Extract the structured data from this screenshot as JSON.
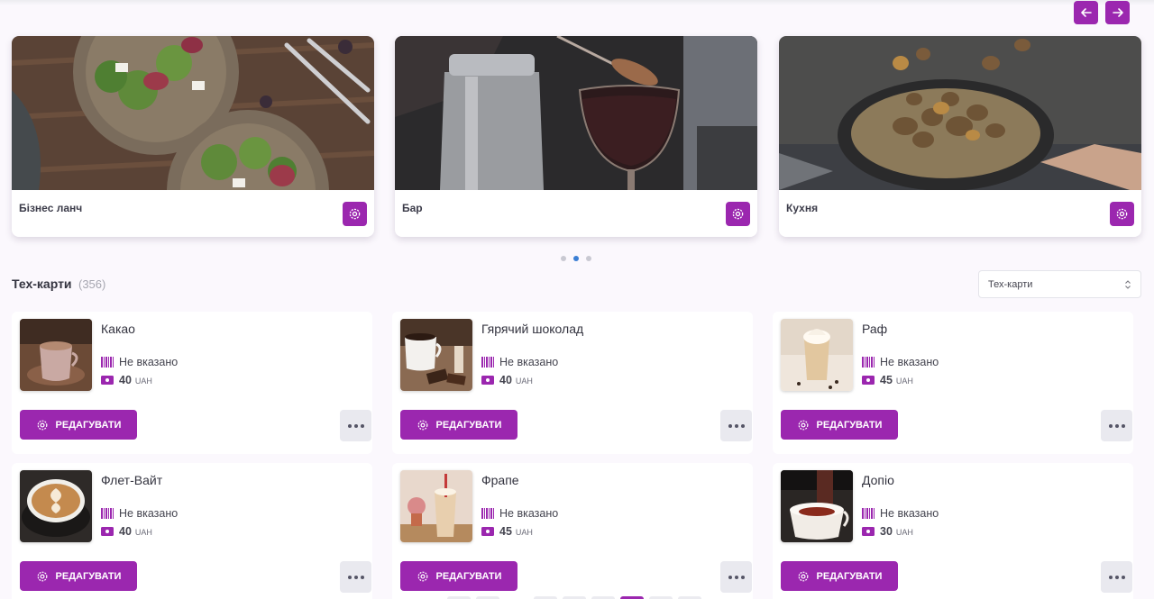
{
  "colors": {
    "accent": "#9b27af",
    "background": "#fbf8fd",
    "dot_active": "#3b7fd4"
  },
  "nav": {
    "prev_icon": "arrow-left-icon",
    "next_icon": "arrow-right-icon"
  },
  "categories": [
    {
      "title": "Бізнес ланч"
    },
    {
      "title": "Бар"
    },
    {
      "title": "Кухня"
    }
  ],
  "carousel": {
    "pages": 3,
    "active_page": 2
  },
  "section": {
    "title": "Тех-карти",
    "count": "(356)"
  },
  "filter": {
    "selected": "Тех-карти"
  },
  "items": [
    {
      "name": "Какао",
      "sku": "Не вказано",
      "price": "40",
      "currency": "UAH"
    },
    {
      "name": "Гярячий шоколад",
      "sku": "Не вказано",
      "price": "40",
      "currency": "UAH"
    },
    {
      "name": "Раф",
      "sku": "Не вказано",
      "price": "45",
      "currency": "UAH"
    },
    {
      "name": "Флет-Вайт",
      "sku": "Не вказано",
      "price": "40",
      "currency": "UAH"
    },
    {
      "name": "Фрапе",
      "sku": "Не вказано",
      "price": "45",
      "currency": "UAH"
    },
    {
      "name": "Допіо",
      "sku": "Не вказано",
      "price": "30",
      "currency": "UAH"
    }
  ],
  "actions": {
    "edit_label": "РЕДАГУВАТИ"
  }
}
